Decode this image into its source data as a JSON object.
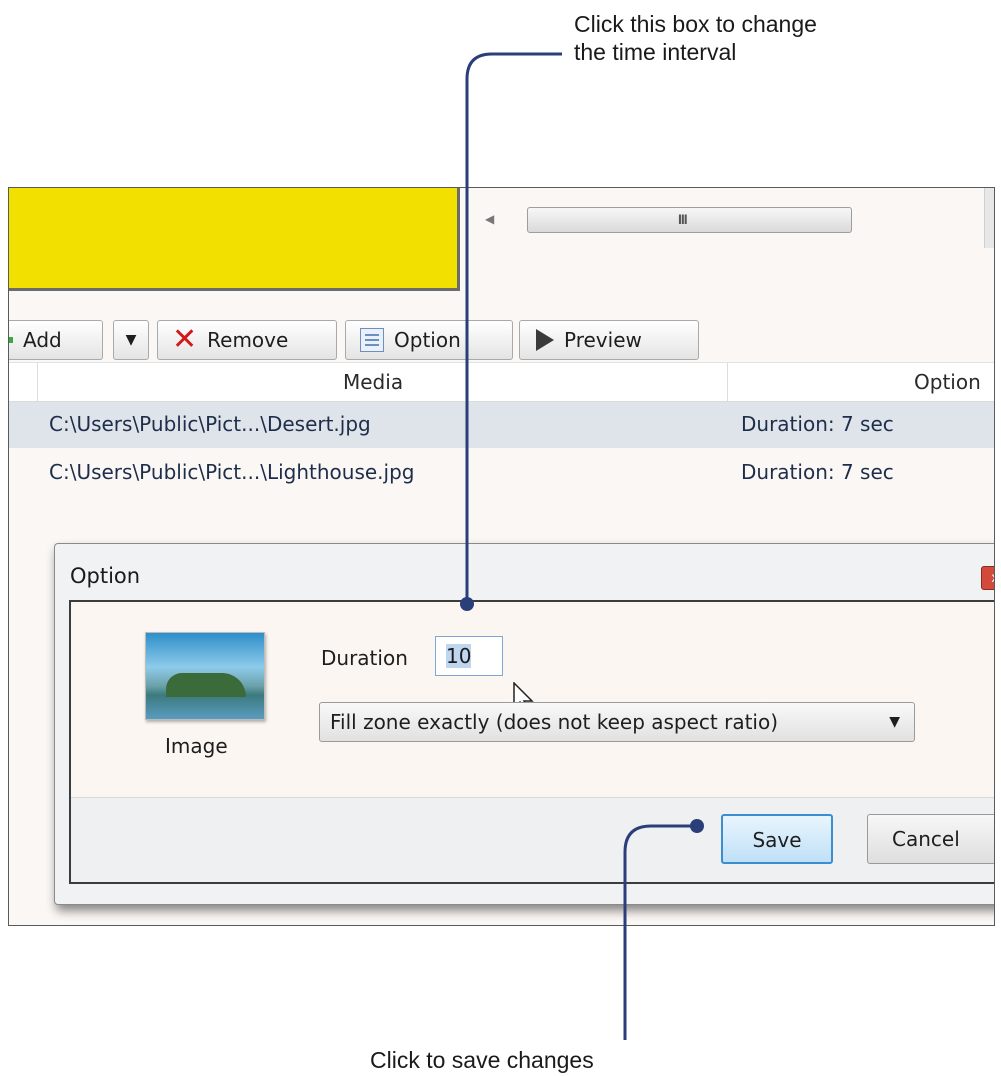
{
  "callouts": {
    "top_text": "Click this box to change\nthe time interval",
    "bottom_text": "Click to save changes",
    "line_color": "#2a3f7a"
  },
  "toolbar": {
    "add_label": "Add",
    "remove_label": "Remove",
    "option_label": "Option",
    "preview_label": "Preview"
  },
  "list": {
    "headers": [
      "Media",
      "Option"
    ],
    "rows": [
      {
        "media": "C:\\Users\\Public\\Pict...\\Desert.jpg",
        "option": "Duration: 7 sec"
      },
      {
        "media": "C:\\Users\\Public\\Pict...\\Lighthouse.jpg",
        "option": "Duration: 7 sec"
      }
    ]
  },
  "dialog": {
    "title": "Option",
    "image_label": "Image",
    "duration_label": "Duration",
    "duration_value": "10",
    "fill_mode": "Fill zone exactly (does not keep aspect ratio)",
    "save_label": "Save",
    "cancel_label": "Cancel",
    "close_glyph": "x"
  },
  "colors": {
    "preview_bg": "#f2e100",
    "save_border": "#3b8fd0"
  }
}
